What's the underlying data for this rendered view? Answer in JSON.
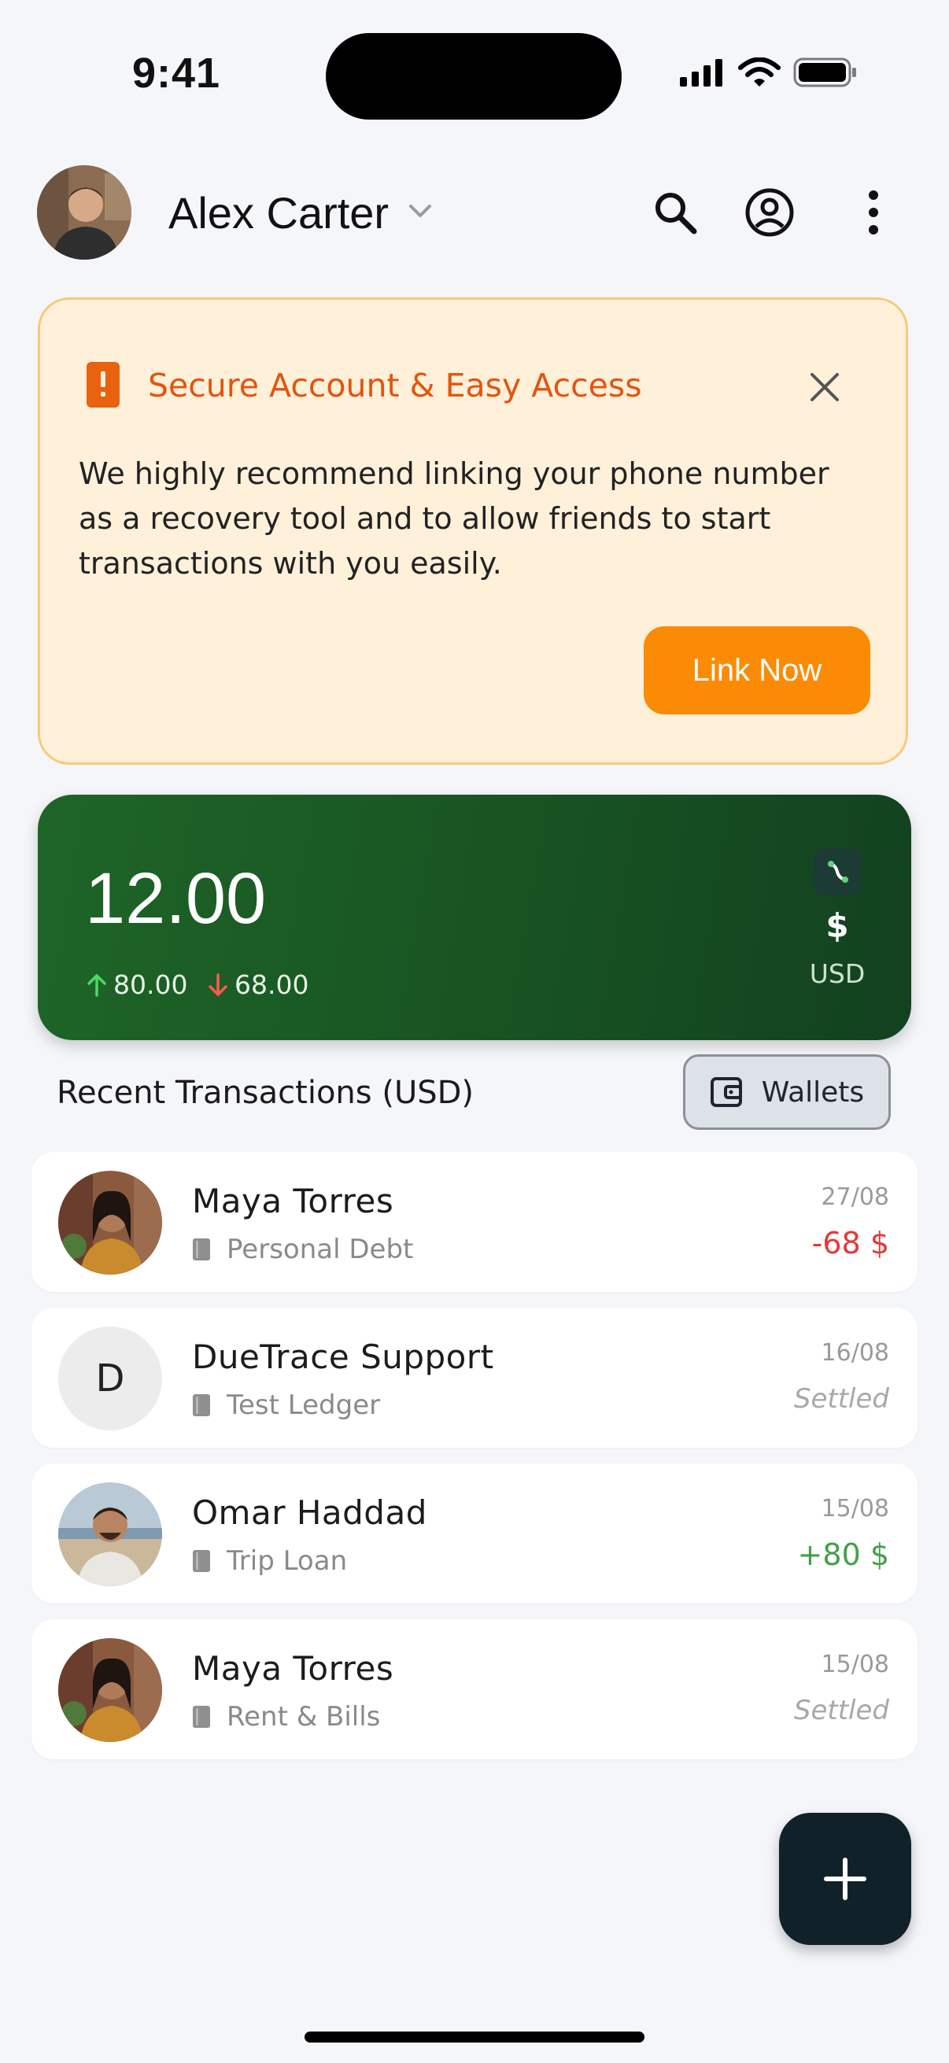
{
  "status_bar": {
    "time": "9:41"
  },
  "header": {
    "user_name": "Alex Carter",
    "icons": [
      "chevron-down-icon",
      "search-icon",
      "account-circle-icon",
      "more-vertical-icon"
    ]
  },
  "banner": {
    "title": "Secure Account & Easy Access",
    "message": "We highly recommend linking your phone number as a recovery tool and to allow friends to start transactions with you easily.",
    "button_label": "Link Now",
    "accent_color": "#e3540e",
    "button_color": "#fb8b04"
  },
  "balance": {
    "amount": "12.00",
    "incoming": "80.00",
    "outgoing": "68.00",
    "currency_symbol": "$",
    "currency_code": "USD",
    "card_color": "#1a5a24"
  },
  "transactions_section": {
    "title": "Recent Transactions (USD)",
    "wallets_label": "Wallets"
  },
  "transactions": [
    {
      "name": "Maya Torres",
      "ledger": "Personal Debt",
      "date": "27/08",
      "amount": "-68 $",
      "status": "amount-negative",
      "avatar": "photo"
    },
    {
      "name": "DueTrace Support",
      "ledger": "Test Ledger",
      "date": "16/08",
      "amount": "Settled",
      "status": "settled",
      "avatar": "initial",
      "initial": "D"
    },
    {
      "name": "Omar Haddad",
      "ledger": "Trip Loan",
      "date": "15/08",
      "amount": "+80 $",
      "status": "amount-positive",
      "avatar": "photo"
    },
    {
      "name": "Maya Torres",
      "ledger": "Rent & Bills",
      "date": "15/08",
      "amount": "Settled",
      "status": "settled",
      "avatar": "photo"
    }
  ],
  "colors": {
    "negative": "#e53935",
    "positive": "#43a047",
    "fab": "#10212a"
  }
}
